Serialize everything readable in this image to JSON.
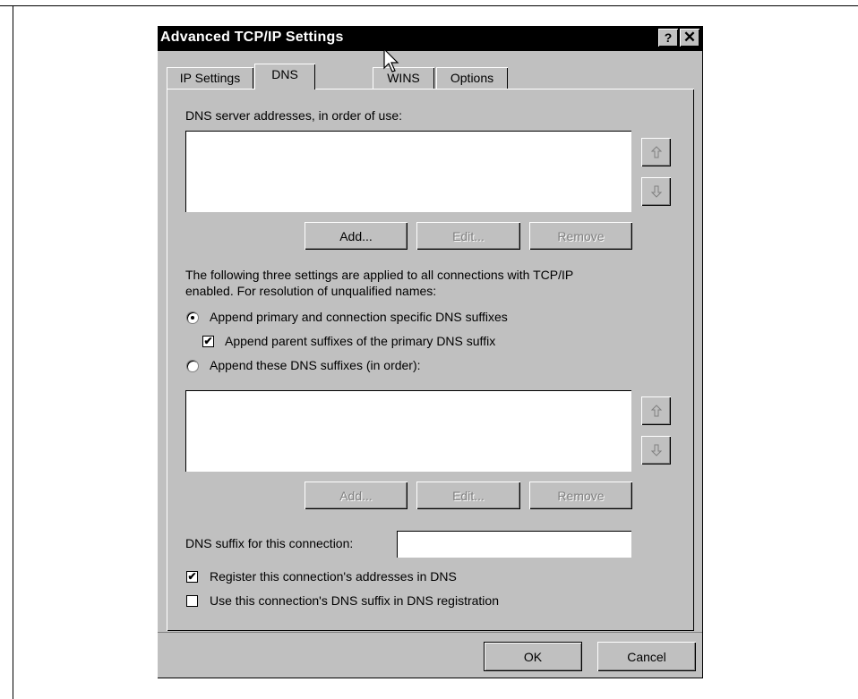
{
  "dialog": {
    "title": "Advanced TCP/IP Settings",
    "help_button": "?",
    "close_button": "✕"
  },
  "tabs": [
    {
      "label": "IP Settings",
      "active": false
    },
    {
      "label": "DNS",
      "active": true
    },
    {
      "label": "WINS",
      "active": false
    },
    {
      "label": "Options",
      "active": false
    }
  ],
  "dns_servers": {
    "label": "DNS server addresses, in order of use:",
    "items": [],
    "buttons": {
      "add": "Add...",
      "edit": "Edit...",
      "remove": "Remove"
    }
  },
  "info_text": {
    "line1": "The following three settings are applied to all connections with TCP/IP",
    "line2": "enabled. For resolution of unqualified names:"
  },
  "options": {
    "append_primary": {
      "label": "Append primary and connection specific DNS suffixes",
      "selected": true
    },
    "append_parent": {
      "label": "Append parent suffixes of the primary DNS suffix",
      "checked": true
    },
    "append_these": {
      "label": "Append these DNS suffixes (in order):",
      "selected": false
    }
  },
  "dns_suffixes": {
    "items": [],
    "buttons": {
      "add": "Add...",
      "edit": "Edit...",
      "remove": "Remove"
    }
  },
  "suffix_field": {
    "label": "DNS suffix for this connection:",
    "value": ""
  },
  "register": {
    "label": "Register this connection's addresses in DNS",
    "checked": true
  },
  "use_suffix": {
    "label": "Use this connection's DNS suffix in DNS registration",
    "checked": false
  },
  "footer": {
    "ok": "OK",
    "cancel": "Cancel"
  },
  "icons": {
    "up_arrow": "up-arrow-icon",
    "down_arrow": "down-arrow-icon",
    "check": "✔"
  }
}
